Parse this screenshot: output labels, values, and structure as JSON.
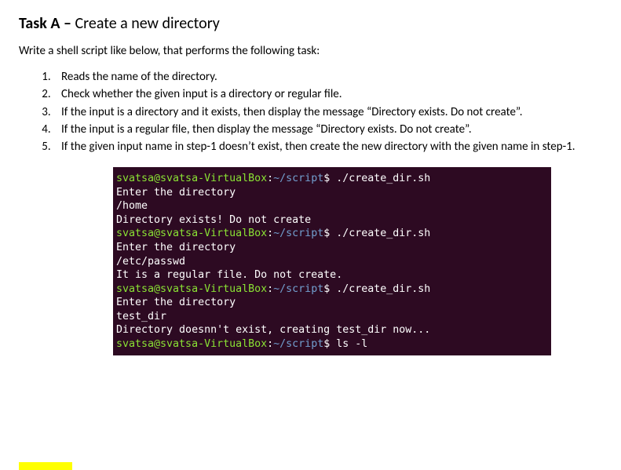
{
  "title": {
    "label": "Task A",
    "dash": " – ",
    "name": "Create a new directory"
  },
  "intro": "Write a shell script like below, that performs the following task:",
  "steps": [
    "Reads the name of the directory.",
    "Check whether the given input is a directory or regular file.",
    "If the input is a directory and it exists, then display the message “Directory exists.  Do not create”.",
    "If the input is a regular file, then display the message “Directory exists.  Do not create”.",
    "If the given input name in step-1 doesn’t exist, then create the new directory with the given name in step-1."
  ],
  "terminal": {
    "user": "svatsa@svatsa-VirtualBox",
    "sep": ":",
    "path": "~/script",
    "dollar": "$ ",
    "lines": [
      {
        "type": "prompt",
        "cmd": "./create_dir.sh"
      },
      {
        "type": "out",
        "text": "Enter the directory"
      },
      {
        "type": "out",
        "text": "/home"
      },
      {
        "type": "out",
        "text": "Directory exists! Do not create"
      },
      {
        "type": "prompt",
        "cmd": "./create_dir.sh"
      },
      {
        "type": "out",
        "text": "Enter the directory"
      },
      {
        "type": "out",
        "text": "/etc/passwd"
      },
      {
        "type": "out",
        "text": "It is a regular file. Do not create."
      },
      {
        "type": "prompt",
        "cmd": "./create_dir.sh"
      },
      {
        "type": "out",
        "text": "Enter the directory"
      },
      {
        "type": "out",
        "text": "test_dir"
      },
      {
        "type": "out",
        "text": "Directory doesnn't exist, creating test_dir now..."
      },
      {
        "type": "prompt",
        "cmd": "ls -l"
      }
    ]
  }
}
